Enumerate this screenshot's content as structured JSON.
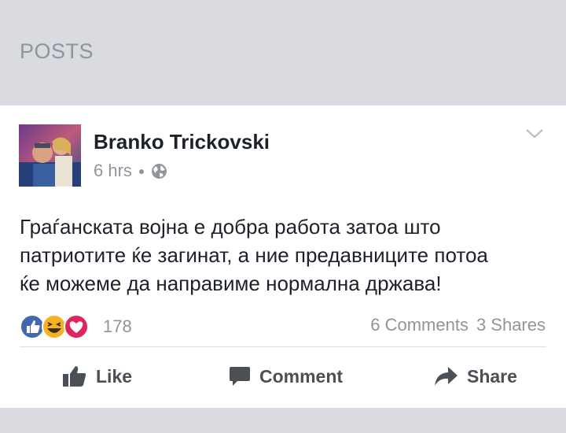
{
  "header": {
    "title": "POSTS"
  },
  "post": {
    "author": "Branko Trickovski",
    "time": "6 hrs",
    "privacy_icon": "globe-icon",
    "text_lines": [
      "Граѓанската војна е добра работа затоа што",
      "патриотите ќе загинат, а ние предавниците потоа",
      "ќе можеме да направиме нормална држава!"
    ],
    "reactions": {
      "icons": [
        "like-reaction-icon",
        "haha-reaction-icon",
        "love-reaction-icon"
      ],
      "count": "178"
    },
    "comments": "6 Comments",
    "shares": "3 Shares"
  },
  "actions": {
    "like": "Like",
    "comment": "Comment",
    "share": "Share"
  },
  "colors": {
    "like_blue": "#4267b2",
    "love_red": "#e0245e",
    "haha_yellow": "#f7b125",
    "text_gray": "#90949c",
    "action_gray": "#4b4f56"
  }
}
